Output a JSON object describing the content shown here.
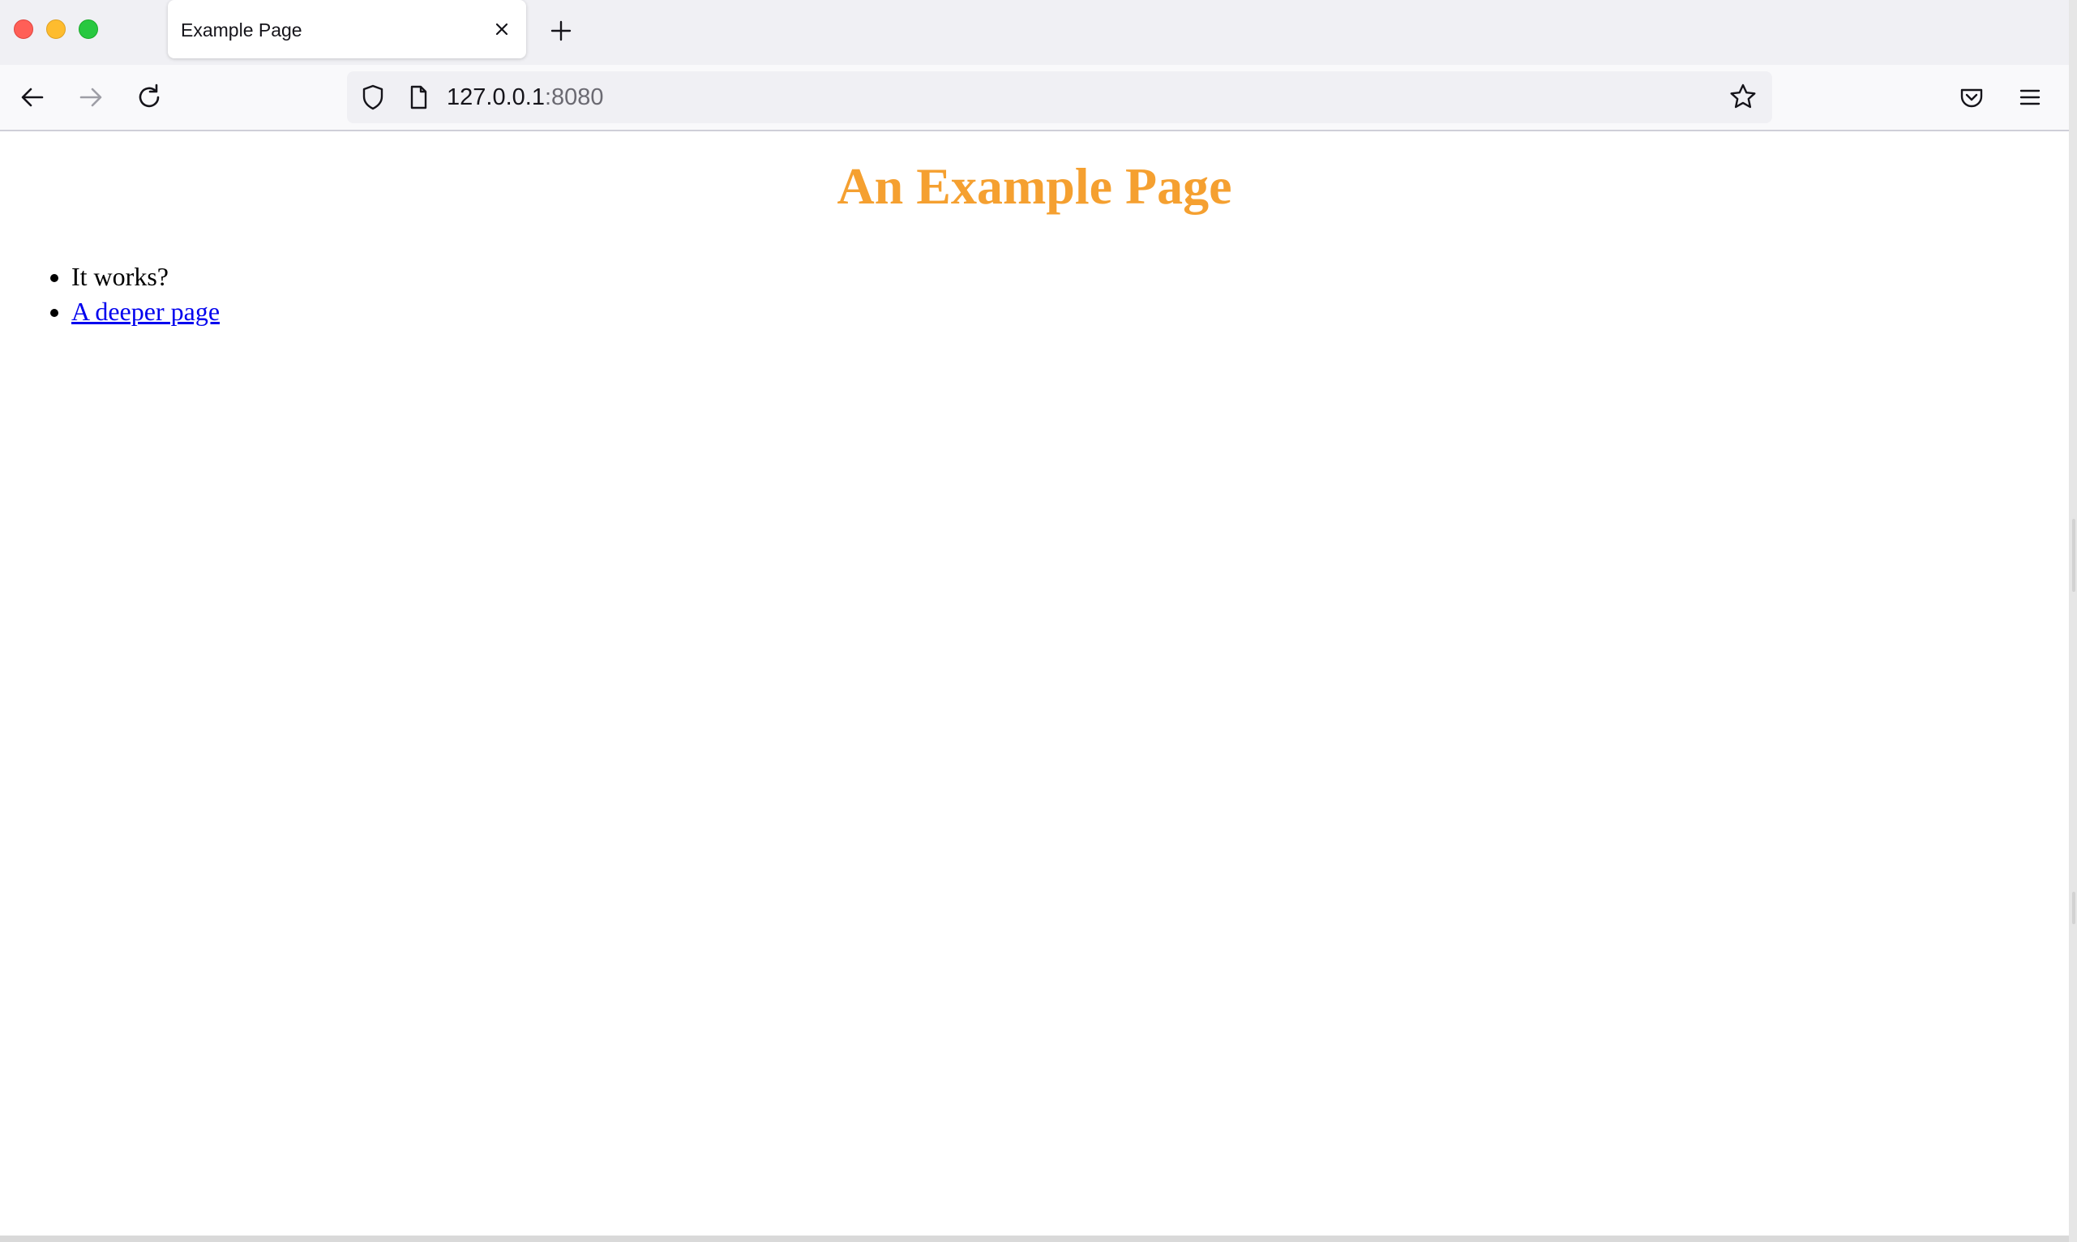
{
  "browser": {
    "tab": {
      "title": "Example Page"
    },
    "toolbar": {
      "url_host": "127.0.0.1",
      "url_port": ":8080"
    },
    "icons": {
      "window_controls": [
        "close-dot",
        "minimize-dot",
        "maximize-dot"
      ],
      "tab_close": "close-icon",
      "new_tab": "plus-icon",
      "back": "arrow-left-icon",
      "forward": "arrow-right-icon",
      "reload": "reload-icon",
      "tracking_protection": "shield-icon",
      "page_info": "document-icon",
      "bookmark": "star-icon",
      "pocket": "pocket-icon",
      "menu": "hamburger-menu-icon"
    }
  },
  "page": {
    "title": "An Example Page",
    "title_color": "#f5a030",
    "items": [
      {
        "text": "It works?"
      },
      {
        "text": "A deeper page",
        "link_color": "#0000ee"
      }
    ]
  }
}
